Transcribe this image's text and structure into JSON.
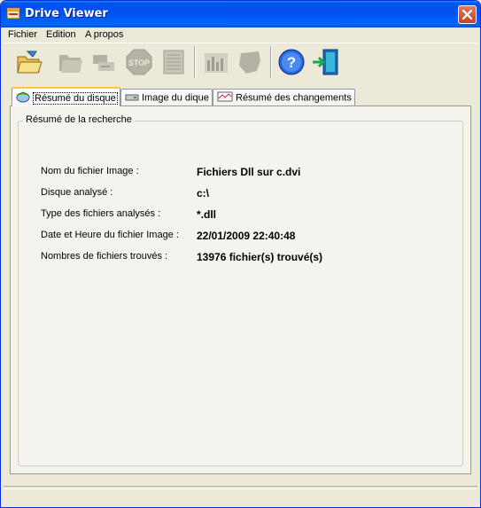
{
  "window": {
    "title": "Drive Viewer"
  },
  "menu": [
    "Fichier",
    "Edition",
    "A propos"
  ],
  "toolbar": {
    "buttons": [
      {
        "name": "open-icon",
        "enabled": true
      },
      {
        "name": "folders-icon",
        "enabled": false
      },
      {
        "name": "drive-scan-icon",
        "enabled": false
      },
      {
        "name": "stop-icon",
        "enabled": false,
        "text": "STOP"
      },
      {
        "name": "list-icon",
        "enabled": false
      },
      {
        "name": "chart-icon",
        "enabled": false
      },
      {
        "name": "map-icon",
        "enabled": false
      },
      {
        "name": "help-icon",
        "enabled": true,
        "text": "?"
      },
      {
        "name": "exit-icon",
        "enabled": true
      }
    ]
  },
  "tabs": [
    {
      "label": "Résumé du disque",
      "active": true
    },
    {
      "label": "Image du dique",
      "active": false
    },
    {
      "label": "Résumé des changements",
      "active": false
    }
  ],
  "group": {
    "title": "Résumé de la recherche",
    "rows": [
      {
        "label": "Nom du fichier Image :",
        "value": "Fichiers Dll sur c.dvi"
      },
      {
        "label": "Disque analysé :",
        "value": "c:\\"
      },
      {
        "label": "Type des fichiers analysés :",
        "value": "*.dll"
      },
      {
        "label": "Date et Heure du fichier Image :",
        "value": "22/01/2009 22:40:48"
      },
      {
        "label": "Nombres de fichiers trouvés :",
        "value": "13976 fichier(s) trouvé(s)"
      }
    ]
  },
  "colors": {
    "titlebar": "#0053ee",
    "face": "#ece9d8",
    "tab_highlight": "#ffc83c"
  }
}
